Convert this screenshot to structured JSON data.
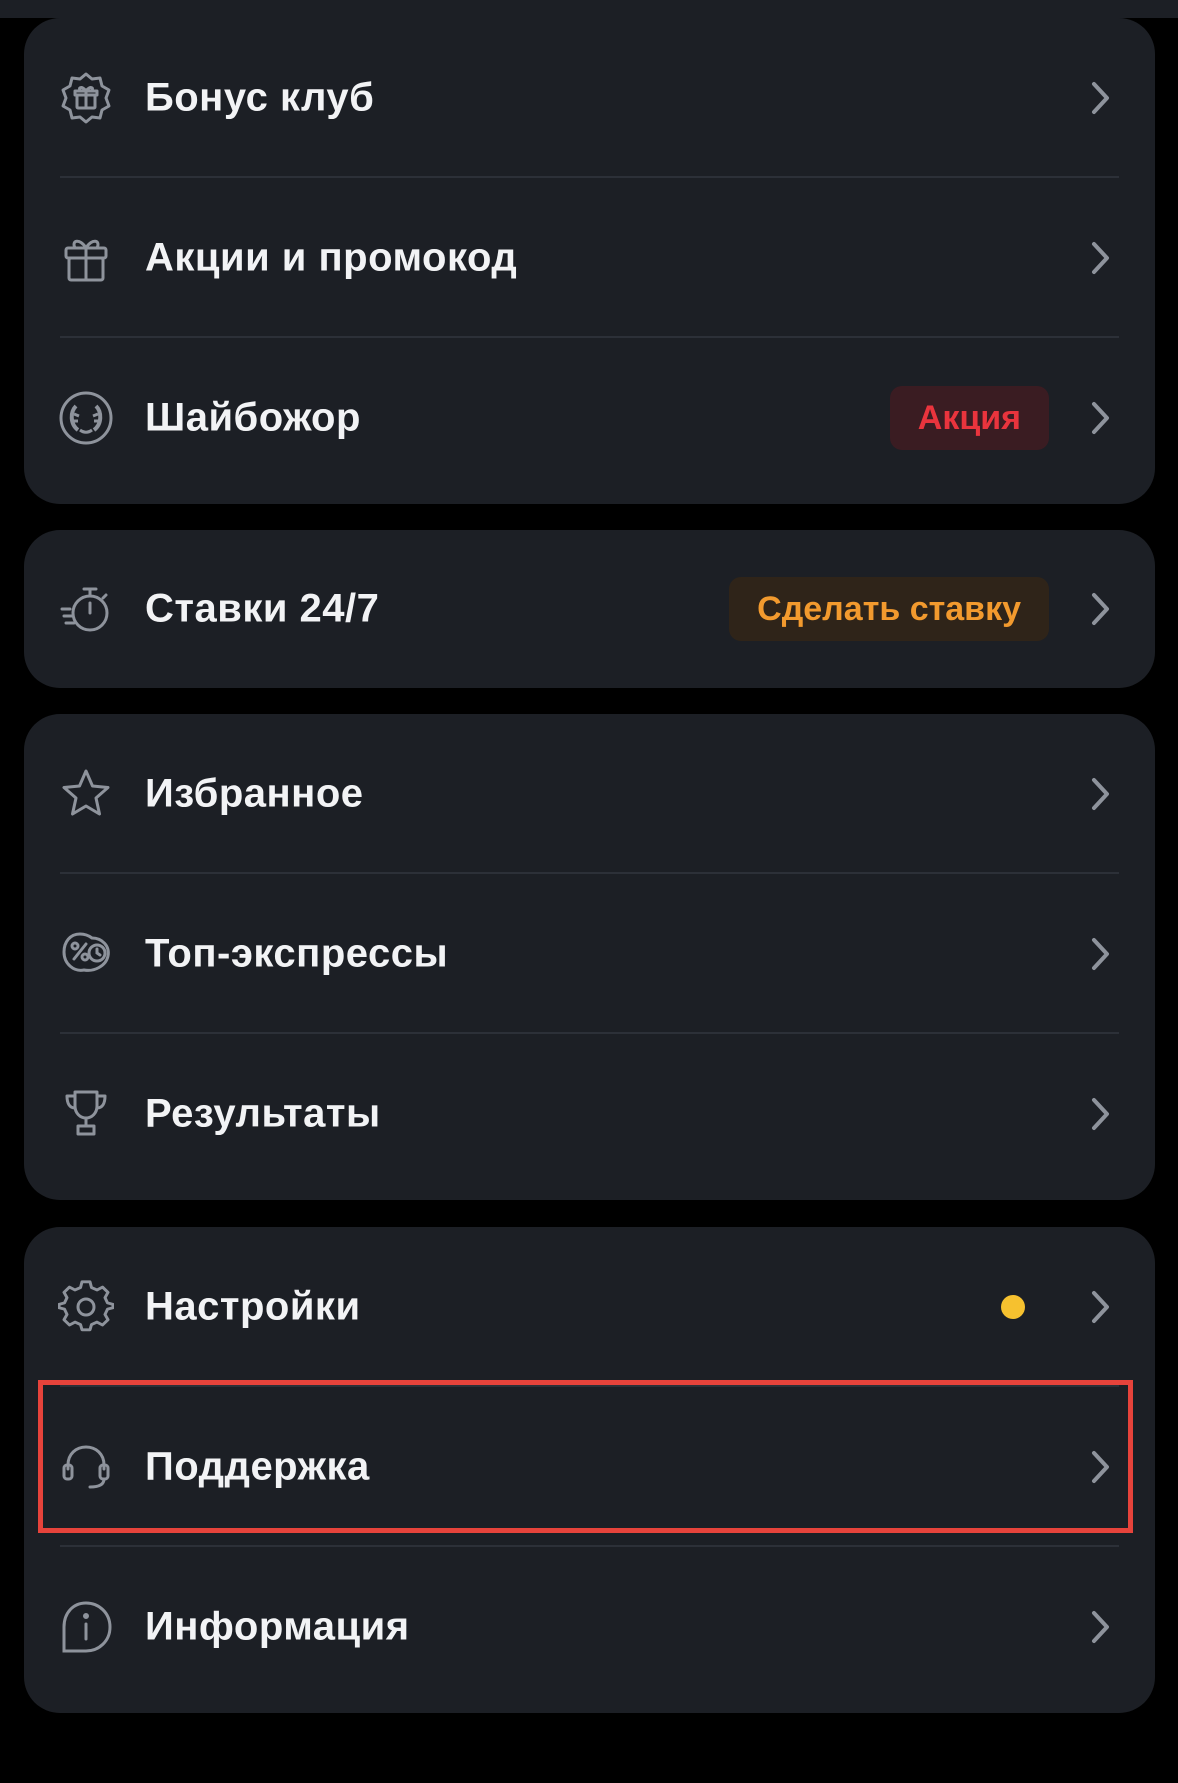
{
  "menu": {
    "group1": [
      {
        "label": "Бонус клуб",
        "icon": "bonus-club-icon"
      },
      {
        "label": "Акции и промокод",
        "icon": "gift-icon"
      },
      {
        "label": "Шайбожор",
        "icon": "laurel-icon",
        "badge": "Акция"
      }
    ],
    "group2": [
      {
        "label": "Ставки 24/7",
        "icon": "stopwatch-icon",
        "badge": "Сделать ставку"
      }
    ],
    "group3": [
      {
        "label": "Избранное",
        "icon": "star-icon"
      },
      {
        "label": "Топ-экспрессы",
        "icon": "express-icon"
      },
      {
        "label": "Результаты",
        "icon": "trophy-icon"
      }
    ],
    "group4": [
      {
        "label": "Настройки",
        "icon": "gear-icon",
        "indicator_color": "#f6c12f"
      },
      {
        "label": "Поддержка",
        "icon": "headset-icon",
        "highlighted": true
      },
      {
        "label": "Информация",
        "icon": "info-icon"
      }
    ]
  },
  "colors": {
    "background": "#000000",
    "card": "#1c1f25",
    "badge_red": "#e9343d",
    "badge_orange": "#f29a2e",
    "highlight_border": "#e6433b"
  }
}
